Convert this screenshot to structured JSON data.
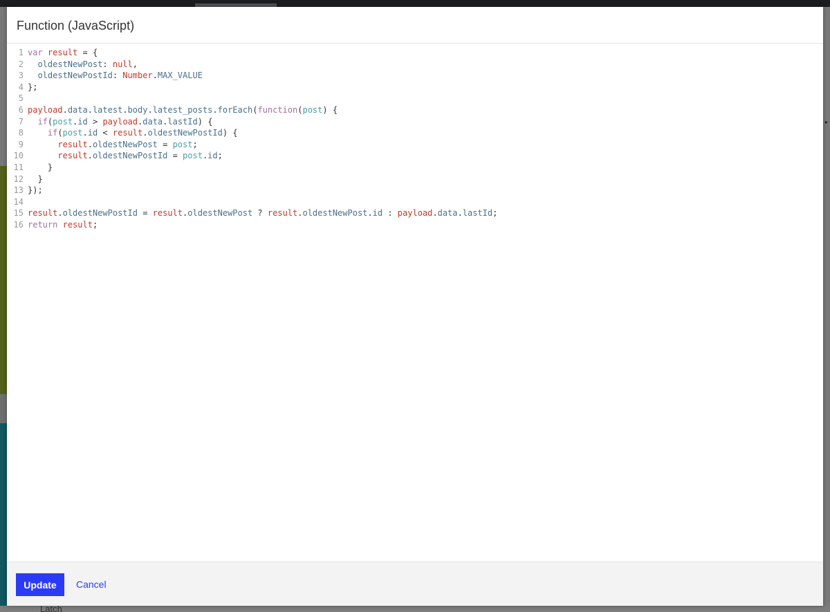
{
  "modal": {
    "title": "Function (JavaScript)",
    "update_label": "Update",
    "cancel_label": "Cancel"
  },
  "background": {
    "latch_label": "Latch"
  },
  "code": {
    "line_numbers": [
      "1",
      "2",
      "3",
      "4",
      "5",
      "6",
      "7",
      "8",
      "9",
      "10",
      "11",
      "12",
      "13",
      "14",
      "15",
      "16"
    ],
    "lines": [
      "var result = {",
      "  oldestNewPost: null,",
      "  oldestNewPostId: Number.MAX_VALUE",
      "};",
      "",
      "payload.data.latest.body.latest_posts.forEach(function(post) {",
      "  if(post.id > payload.data.lastId) {",
      "    if(post.id < result.oldestNewPostId) {",
      "      result.oldestNewPost = post;",
      "      result.oldestNewPostId = post.id;",
      "    }",
      "  }",
      "});",
      "",
      "result.oldestNewPostId = result.oldestNewPost ? result.oldestNewPost.id : payload.data.lastId;",
      "return result;"
    ]
  },
  "colors": {
    "primary": "#2b3bf5",
    "keyword": "#a56fa7",
    "variable": "#c0392b",
    "property": "#4a6f8a",
    "param": "#4f9ea8"
  }
}
